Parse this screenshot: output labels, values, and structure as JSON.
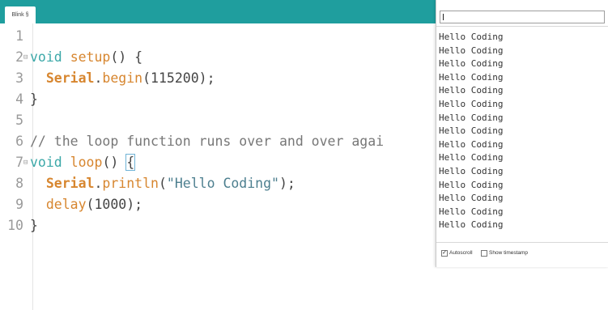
{
  "editor": {
    "tab_label": "Blink §",
    "lines": [
      {
        "num": "1",
        "parts": []
      },
      {
        "num": "2",
        "fold": "⊟",
        "parts": [
          [
            "kw",
            "void"
          ],
          [
            "p",
            " "
          ],
          [
            "fn",
            "setup"
          ],
          [
            "p",
            "() {"
          ]
        ]
      },
      {
        "num": "3",
        "parts": [
          [
            "p",
            "  "
          ],
          [
            "cls",
            "Serial"
          ],
          [
            "p",
            "."
          ],
          [
            "fn",
            "begin"
          ],
          [
            "p",
            "(115200);"
          ]
        ]
      },
      {
        "num": "4",
        "parts": [
          [
            "p",
            "}"
          ]
        ]
      },
      {
        "num": "5",
        "parts": []
      },
      {
        "num": "6",
        "parts": [
          [
            "cmt",
            "// the loop function runs over and over agai"
          ]
        ]
      },
      {
        "num": "7",
        "fold": "⊟",
        "parts": [
          [
            "kw",
            "void"
          ],
          [
            "p",
            " "
          ],
          [
            "fn",
            "loop"
          ],
          [
            "p",
            "() "
          ],
          [
            "cur",
            "{"
          ]
        ]
      },
      {
        "num": "8",
        "parts": [
          [
            "p",
            "  "
          ],
          [
            "cls",
            "Serial"
          ],
          [
            "p",
            "."
          ],
          [
            "fn",
            "println"
          ],
          [
            "p",
            "("
          ],
          [
            "str",
            "\"Hello Coding\""
          ],
          [
            "p",
            ");"
          ]
        ]
      },
      {
        "num": "9",
        "parts": [
          [
            "p",
            "  "
          ],
          [
            "fn",
            "delay"
          ],
          [
            "p",
            "(1000);"
          ]
        ]
      },
      {
        "num": "10",
        "parts": [
          [
            "p",
            "}"
          ]
        ]
      }
    ]
  },
  "serial_monitor": {
    "input_value": "",
    "output_lines": [
      "Hello Coding",
      "Hello Coding",
      "Hello Coding",
      "Hello Coding",
      "Hello Coding",
      "Hello Coding",
      "Hello Coding",
      "Hello Coding",
      "Hello Coding",
      "Hello Coding",
      "Hello Coding",
      "Hello Coding",
      "Hello Coding",
      "Hello Coding",
      "Hello Coding"
    ],
    "autoscroll_label": "Autoscroll",
    "autoscroll_checked": true,
    "timestamp_label": "Show timestamp",
    "timestamp_checked": false
  },
  "colors": {
    "header_teal": "#1f9e9e",
    "keyword": "#3ba8a8",
    "function": "#d7862f",
    "string": "#4d7f8f"
  }
}
